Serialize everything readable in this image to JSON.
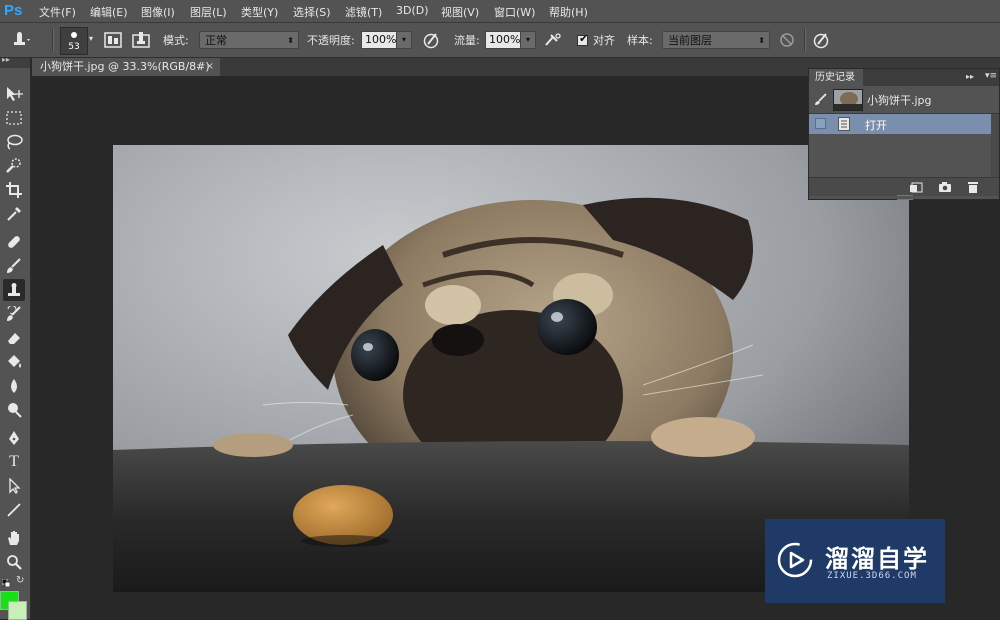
{
  "app": {
    "logo": "Ps"
  },
  "menu": [
    "文件(F)",
    "编辑(E)",
    "图像(I)",
    "图层(L)",
    "类型(Y)",
    "选择(S)",
    "滤镜(T)",
    "3D(D)",
    "视图(V)",
    "窗口(W)",
    "帮助(H)"
  ],
  "options": {
    "brush_size": "53",
    "mode_label": "模式:",
    "mode_value": "正常",
    "opacity_label": "不透明度:",
    "opacity_value": "100%",
    "flow_label": "流量:",
    "flow_value": "100%",
    "aligned_label": "对齐",
    "aligned_checked": true,
    "sample_label": "样本:",
    "sample_value": "当前图层"
  },
  "document": {
    "tab_title": "小狗饼干.jpg @ 33.3%(RGB/8#)",
    "close": "×"
  },
  "history": {
    "tab_title": "历史记录",
    "snapshot_label": "小狗饼干.jpg",
    "states": [
      {
        "label": "打开"
      }
    ]
  },
  "tools": [
    "move-tool",
    "marquee-tool",
    "lasso-tool",
    "quick-select-tool",
    "crop-tool",
    "eyedropper-tool",
    "healing-brush-tool",
    "brush-tool",
    "clone-stamp-tool",
    "history-brush-tool",
    "eraser-tool",
    "paint-bucket-tool",
    "blur-tool",
    "dodge-tool",
    "pen-tool",
    "type-tool",
    "path-select-tool",
    "line-tool",
    "hand-tool",
    "zoom-tool"
  ],
  "colors": {
    "foreground": "#18e018",
    "background": "#c8efb8",
    "accent": "#7a8fad"
  },
  "watermark": {
    "title": "溜溜自学",
    "subtitle": "ZIXUE.3D66.COM"
  }
}
